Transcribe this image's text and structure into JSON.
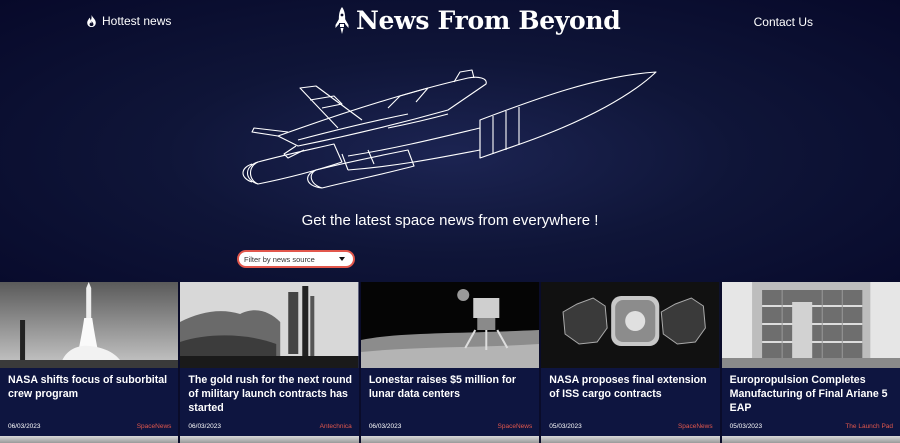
{
  "header": {
    "hottest_label": "Hottest news",
    "brand_title": "News From Beyond",
    "contact_label": "Contact Us"
  },
  "hero": {
    "tagline": "Get the latest space news from everywhere !"
  },
  "filter": {
    "placeholder": "Filter by news source"
  },
  "articles": [
    {
      "title": "NASA shifts focus of suborbital crew program",
      "date": "06/03/2023",
      "source": "SpaceNews"
    },
    {
      "title": "The gold rush for the next round of military launch contracts has started",
      "date": "06/03/2023",
      "source": "Antechnica"
    },
    {
      "title": "Lonestar raises $5 million for lunar data centers",
      "date": "06/03/2023",
      "source": "SpaceNews"
    },
    {
      "title": "NASA proposes final extension of ISS cargo contracts",
      "date": "05/03/2023",
      "source": "SpaceNews"
    },
    {
      "title": "Europropulsion Completes Manufacturing of Final Ariane 5 EAP",
      "date": "05/03/2023",
      "source": "The Launch Pad"
    }
  ],
  "colors": {
    "background": "#0a0c2a",
    "card_background": "#0e1540",
    "accent": "#e2574c"
  },
  "icons": {
    "hottest": "flame-icon",
    "brand": "rocket-icon",
    "filter": "caret-down-icon"
  }
}
